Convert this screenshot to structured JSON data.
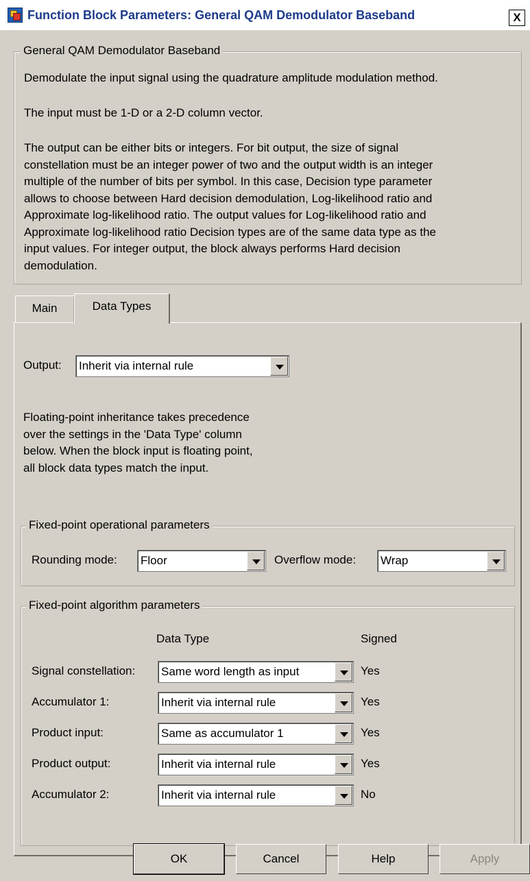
{
  "window": {
    "title": "Function Block Parameters: General QAM Demodulator Baseband",
    "close_label": "X"
  },
  "description": {
    "group_label": "General QAM Demodulator Baseband",
    "paragraph1": "Demodulate the input signal using the quadrature amplitude modulation method.",
    "paragraph2": "The input must be 1-D or a 2-D column vector.",
    "paragraph3_lines": [
      "The output can be either bits or integers. For bit output, the size of signal",
      "constellation must be an integer power of two and the output width is an integer",
      "multiple of the number of bits per symbol. In this case, Decision type parameter",
      "allows to choose between Hard decision demodulation, Log-likelihood ratio and",
      "Approximate log-likelihood ratio. The output values for Log-likelihood ratio and",
      "Approximate log-likelihood ratio Decision types are of the same data type as the",
      "input values. For integer output, the block always performs Hard decision",
      "demodulation."
    ]
  },
  "tabs": [
    {
      "label": "Main",
      "selected": false
    },
    {
      "label": "Data Types",
      "selected": true
    }
  ],
  "output": {
    "label": "Output:",
    "value": "Inherit via internal rule"
  },
  "note_lines": [
    "Floating-point inheritance takes precedence",
    "over the settings in the 'Data Type' column",
    "below. When the block input is floating point,",
    "all block data types match the input."
  ],
  "operational": {
    "group_label": "Fixed-point operational parameters",
    "rounding_label": "Rounding mode:",
    "rounding_value": "Floor",
    "overflow_label": "Overflow mode:",
    "overflow_value": "Wrap"
  },
  "algorithm": {
    "group_label": "Fixed-point algorithm parameters",
    "col_data_type": "Data Type",
    "col_signed": "Signed",
    "rows": [
      {
        "label": "Signal constellation:",
        "value": "Same word length as input",
        "signed": "Yes"
      },
      {
        "label": "Accumulator 1:",
        "value": "Inherit via internal rule",
        "signed": "Yes"
      },
      {
        "label": "Product input:",
        "value": "Same as accumulator 1",
        "signed": "Yes"
      },
      {
        "label": "Product output:",
        "value": "Inherit via internal rule",
        "signed": "Yes"
      },
      {
        "label": "Accumulator 2:",
        "value": "Inherit via internal rule",
        "signed": "No"
      }
    ]
  },
  "buttons": {
    "ok": "OK",
    "cancel": "Cancel",
    "help": "Help",
    "apply": "Apply"
  }
}
